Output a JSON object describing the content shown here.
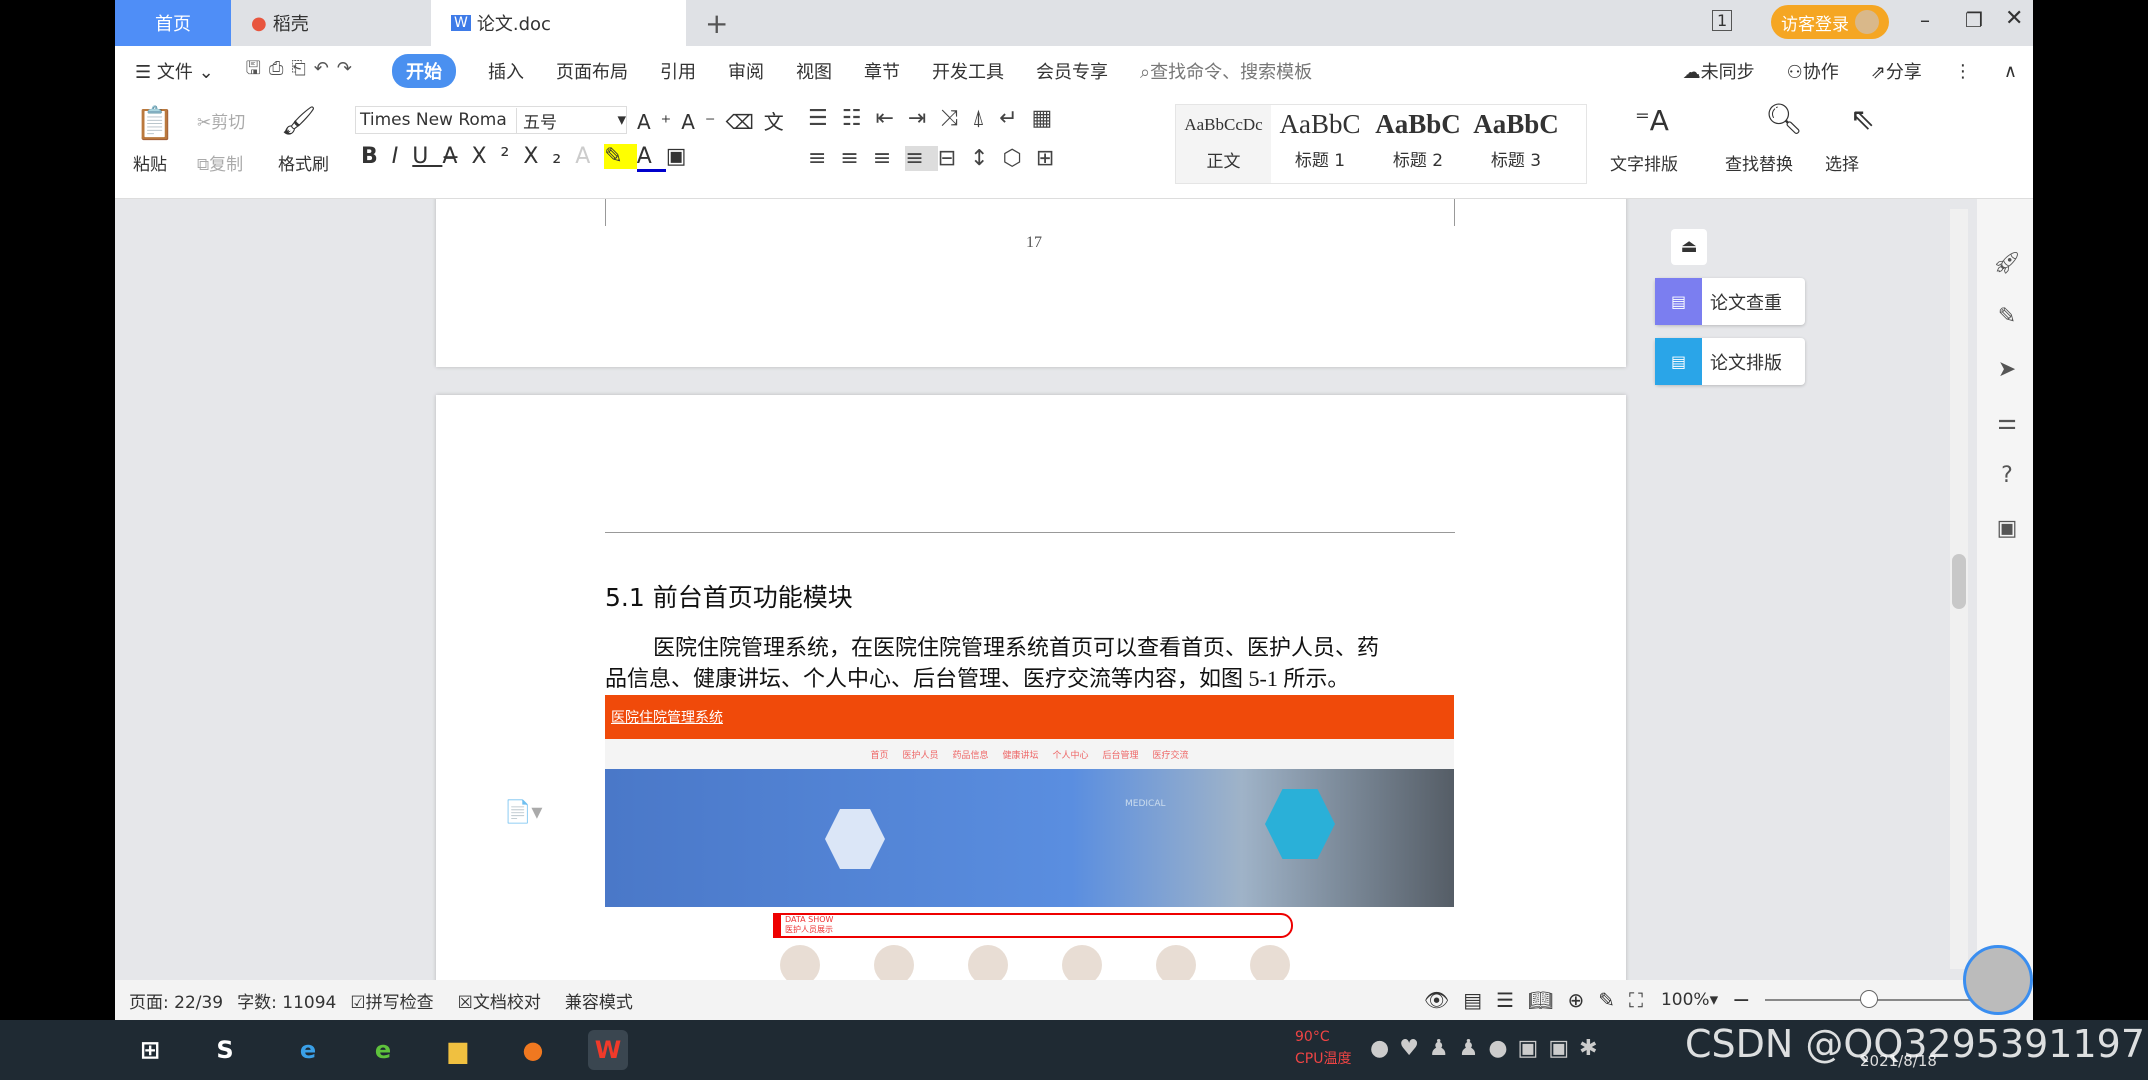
{
  "tabs": [
    {
      "label": "首页"
    },
    {
      "label": "稻壳"
    },
    {
      "label": "论文.doc"
    }
  ],
  "new_tab": "+",
  "login_label": "访客登录",
  "menu": {
    "file": "文件",
    "items": [
      "开始",
      "插入",
      "页面布局",
      "引用",
      "审阅",
      "视图",
      "章节",
      "开发工具",
      "会员专享"
    ],
    "search_placeholder": "查找命令、搜索模板",
    "sync": "未同步",
    "collab": "协作",
    "share": "分享"
  },
  "ribbon": {
    "paste": "粘贴",
    "cut": "剪切",
    "copy": "复制",
    "format_painter": "格式刷",
    "font_name": "Times New Roma",
    "font_size": "五号",
    "styles": [
      {
        "preview": "AaBbCcDc",
        "label": "正文"
      },
      {
        "preview": "AaBbC",
        "label": "标题 1"
      },
      {
        "preview": "AaBbC",
        "label": "标题 2"
      },
      {
        "preview": "AaBbC",
        "label": "标题 3"
      }
    ],
    "text_layout": "文字排版",
    "find_replace": "查找替换",
    "select": "选择"
  },
  "document": {
    "page_number": "17",
    "heading": "5.1 前台首页功能模块",
    "paragraph_line1": "医院住院管理系统，在医院住院管理系统首页可以查看首页、医护人员、药",
    "paragraph_line2": "品信息、健康讲坛、个人中心、后台管理、医疗交流等内容，如图 5-1 所示。",
    "figure": {
      "site_title": "医院住院管理系统",
      "nav": [
        "首页",
        "医护人员",
        "药品信息",
        "健康讲坛",
        "个人中心",
        "后台管理",
        "医疗交流"
      ],
      "banner_text": "MEDICAL",
      "data_show": "DATA SHOW",
      "data_show_sub": "医护人员展示",
      "accent": "#f04a0a"
    }
  },
  "side_panel": {
    "check": "论文查重",
    "layout": "论文排版"
  },
  "status": {
    "page": "页面: 22/39",
    "words": "字数: 11094",
    "spell": "拼写检查",
    "proof": "文档校对",
    "compat": "兼容模式",
    "zoom": "100%"
  },
  "taskbar": {
    "cpu_temp": "90°C",
    "cpu_label": "CPU温度",
    "date": "2021/8/18",
    "watermark": "CSDN @QQ3295391197"
  }
}
